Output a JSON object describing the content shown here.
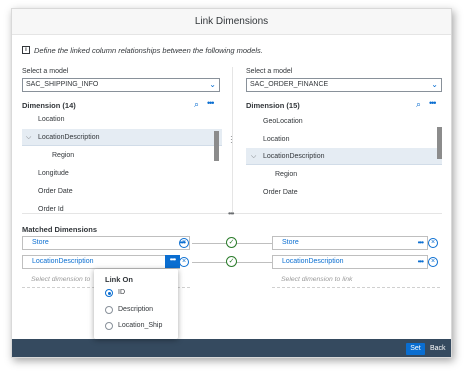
{
  "dialog": {
    "title": "Link Dimensions",
    "info_text": "Define the linked column relationships between the following models.",
    "footer": {
      "set_label": "Set",
      "back_label": "Back"
    }
  },
  "left": {
    "select_label": "Select a model",
    "model": "SAC_SHIPPING_INFO",
    "dimension_header": "Dimension  (14)",
    "items": [
      "Location",
      "LocationDescription",
      "Region",
      "Longitude",
      "Order Date",
      "Order Id"
    ]
  },
  "right": {
    "select_label": "Select a model",
    "model": "SAC_ORDER_FINANCE",
    "dimension_header": "Dimension  (15)",
    "items": [
      "GeoLocation",
      "Location",
      "LocationDescription",
      "Region",
      "Order Date"
    ]
  },
  "matched": {
    "title": "Matched Dimensions",
    "rows": [
      {
        "left": "Store",
        "right": "Store"
      },
      {
        "left": "LocationDescription",
        "right": "LocationDescription"
      }
    ],
    "placeholder_left": "Select dimension to",
    "placeholder_right": "Select dimension to link"
  },
  "popover": {
    "title": "Link On",
    "options": [
      "ID",
      "Description",
      "Location_Ship"
    ],
    "selected": "ID"
  },
  "icons": {
    "search": "search-icon",
    "more": "more-icon",
    "remove": "remove-circle-icon",
    "linked": "check-circle-icon",
    "info": "info-icon"
  },
  "colors": {
    "accent": "#0a6ed1",
    "footer": "#354a5f",
    "selected_row": "#e5ecf3",
    "linked": "#2b7c2b"
  }
}
